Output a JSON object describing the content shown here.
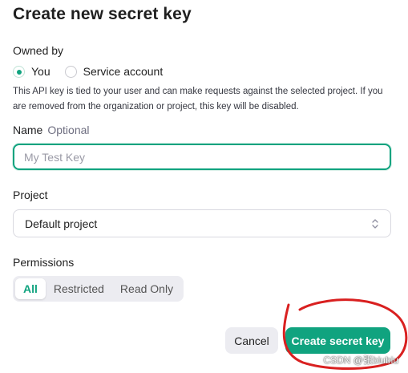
{
  "dialog": {
    "title": "Create new secret key"
  },
  "owned_by": {
    "label": "Owned by",
    "options": [
      "You",
      "Service account"
    ],
    "selected": "You",
    "description": "This API key is tied to your user and can make requests against the selected project. If you are removed from the organization or project, this key will be disabled."
  },
  "name": {
    "label": "Name",
    "optional": "Optional",
    "placeholder": "My Test Key",
    "value": ""
  },
  "project": {
    "label": "Project",
    "selected": "Default project"
  },
  "permissions": {
    "label": "Permissions",
    "options": [
      "All",
      "Restricted",
      "Read Only"
    ],
    "selected": "All"
  },
  "actions": {
    "cancel_label": "Cancel",
    "create_label": "Create secret key"
  },
  "watermark": "CSDN @张biubiu",
  "colors": {
    "accent": "#10a37f",
    "annotation": "#d92020"
  },
  "icons": {
    "select_chevron": "chevron-up-down-icon"
  }
}
